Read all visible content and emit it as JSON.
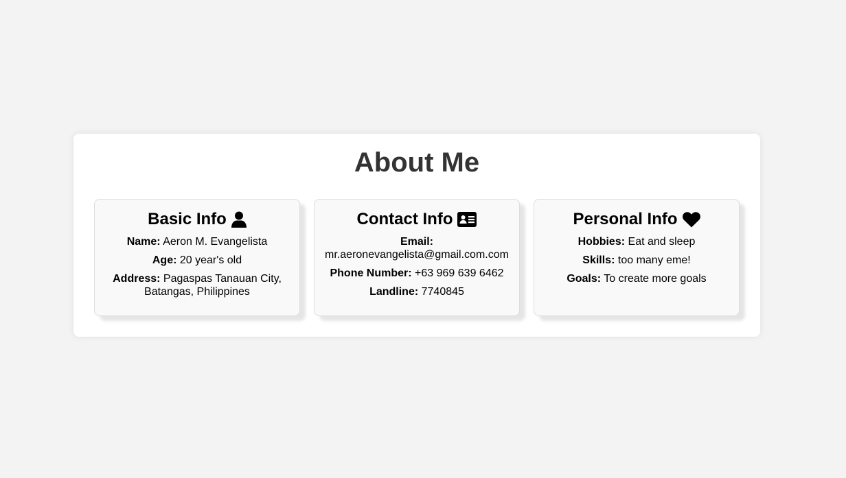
{
  "page": {
    "title": "About Me"
  },
  "cards": [
    {
      "heading": "Basic Info",
      "icon": "user-icon",
      "rows": [
        {
          "label": "Name:",
          "value": "Aeron M. Evangelista"
        },
        {
          "label": "Age:",
          "value": "20 year's old"
        },
        {
          "label": "Address:",
          "value": "Pagaspas Tanauan City, Batangas, Philippines"
        }
      ]
    },
    {
      "heading": "Contact Info",
      "icon": "id-card-icon",
      "rows": [
        {
          "label": "Email:",
          "value": "mr.aeronevangelista@gmail.com.com"
        },
        {
          "label": "Phone Number:",
          "value": "+63 969 639 6462"
        },
        {
          "label": "Landline:",
          "value": "7740845"
        }
      ]
    },
    {
      "heading": "Personal Info",
      "icon": "heart-icon",
      "rows": [
        {
          "label": "Hobbies:",
          "value": "Eat and sleep"
        },
        {
          "label": "Skills:",
          "value": "too many eme!"
        },
        {
          "label": "Goals:",
          "value": "To create more goals"
        }
      ]
    }
  ],
  "colors": {
    "background": "#f3f3f3",
    "panel": "#ffffff",
    "card": "#f9f9f9",
    "card_border": "#dddddd",
    "title_text": "#333333"
  }
}
